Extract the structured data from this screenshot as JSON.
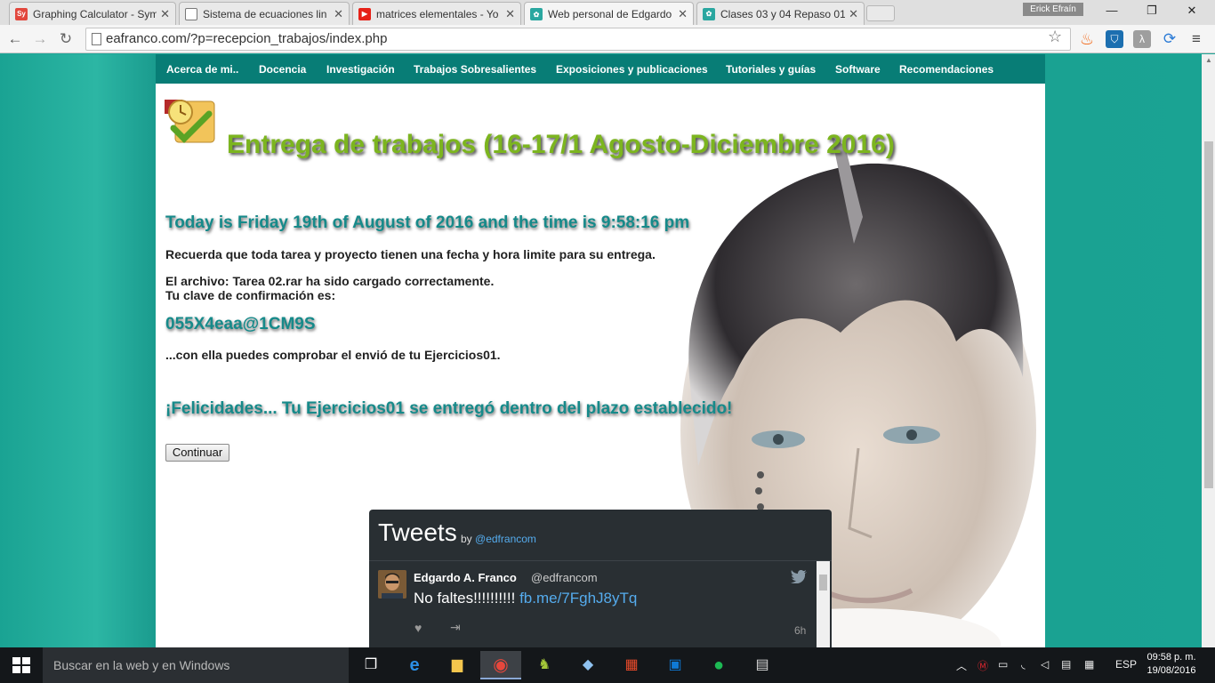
{
  "browser": {
    "tabs": [
      {
        "label": "Graphing Calculator - Sym",
        "icon": "symbolab-icon",
        "color": "#e2473d",
        "icon_text": "Sy"
      },
      {
        "label": "Sistema de ecuaciones lin",
        "icon": "page-icon",
        "color": "#777777",
        "icon_text": ""
      },
      {
        "label": "matrices elementales - Yo",
        "icon": "youtube-icon",
        "color": "#e62117",
        "icon_text": "▶"
      },
      {
        "label": "Web personal de Edgardo",
        "icon": "site-icon",
        "color": "#2aa7a0",
        "icon_text": "✿",
        "active": true
      },
      {
        "label": "Clases 03 y 04 Repaso 01",
        "icon": "site-icon",
        "color": "#2aa7a0",
        "icon_text": "✿"
      }
    ],
    "user": "Erick Efraín",
    "url": "eafranco.com/?p=recepcion_trabajos/index.php"
  },
  "menu": [
    "Acerca de mi..",
    "Docencia",
    "Investigación",
    "Trabajos Sobresalientes",
    "Exposiciones y publicaciones",
    "Tutoriales y guías",
    "Software",
    "Recomendaciones"
  ],
  "page": {
    "title": "Entrega de trabajos (16-17/1 Agosto-Diciembre 2016)",
    "today": "Today is Friday 19th of August of 2016 and the time is 9:58:16 pm",
    "reminder": "Recuerda que toda tarea y proyecto tienen una fecha y hora limite para su entrega.",
    "file_line": "El archivo: Tarea 02.rar ha sido cargado correctamente.",
    "key_label": "Tu clave de confirmación es:",
    "key": "055X4eaa@1CM9S",
    "check": "...con ella puedes comprobar el envió de tu Ejercicios01.",
    "congrats": "¡Felicidades... Tu Ejercicios01 se entregó dentro del plazo establecido!",
    "continue": "Continuar"
  },
  "tweets": {
    "title": "Tweets",
    "by": "by",
    "by_handle": "@edfrancom",
    "name": "Edgardo A. Franco",
    "handle": "@edfrancom",
    "text": "No faltes!!!!!!!!!!",
    "link": "fb.me/7FghJ8yTq",
    "time": "6h"
  },
  "taskbar": {
    "search": "Buscar en la web y en Windows",
    "lang": "ESP",
    "time": "09:58 p. m.",
    "date": "19/08/2016"
  }
}
